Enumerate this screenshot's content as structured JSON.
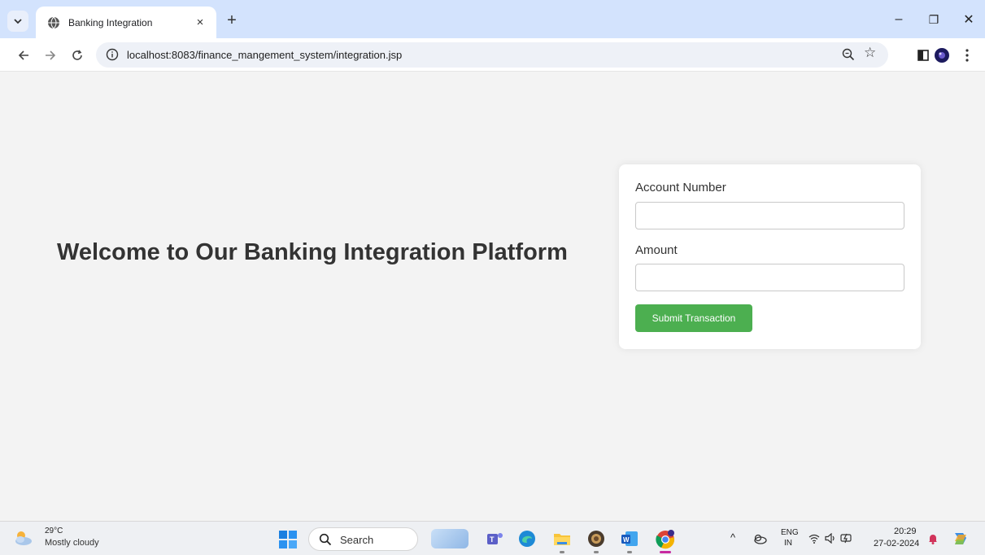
{
  "browser": {
    "tab_title": "Banking Integration",
    "tab_close": "×",
    "new_tab": "+",
    "url": "localhost:8083/finance_mangement_system/integration.jsp",
    "minimize": "–",
    "restore": "❐",
    "close": "✕"
  },
  "page": {
    "heading": "Welcome to Our Banking Integration Platform",
    "form": {
      "account_label": "Account Number",
      "account_value": "",
      "amount_label": "Amount",
      "amount_value": "",
      "submit_label": "Submit Transaction",
      "submit_color": "#4caf50"
    }
  },
  "taskbar": {
    "weather_temp": "29°C",
    "weather_desc": "Mostly cloudy",
    "search_placeholder": "Search",
    "lang_top": "ENG",
    "lang_bottom": "IN",
    "time": "20:29",
    "date": "27-02-2024",
    "apps": [
      "widgets-app-icon",
      "teams-icon",
      "edge-icon",
      "file-explorer-icon",
      "app-icon",
      "word-icon",
      "chrome-icon"
    ]
  },
  "colors": {
    "tabstrip": "#d3e3fd",
    "page_bg": "#f3f3f3",
    "accent_green": "#4caf50"
  }
}
